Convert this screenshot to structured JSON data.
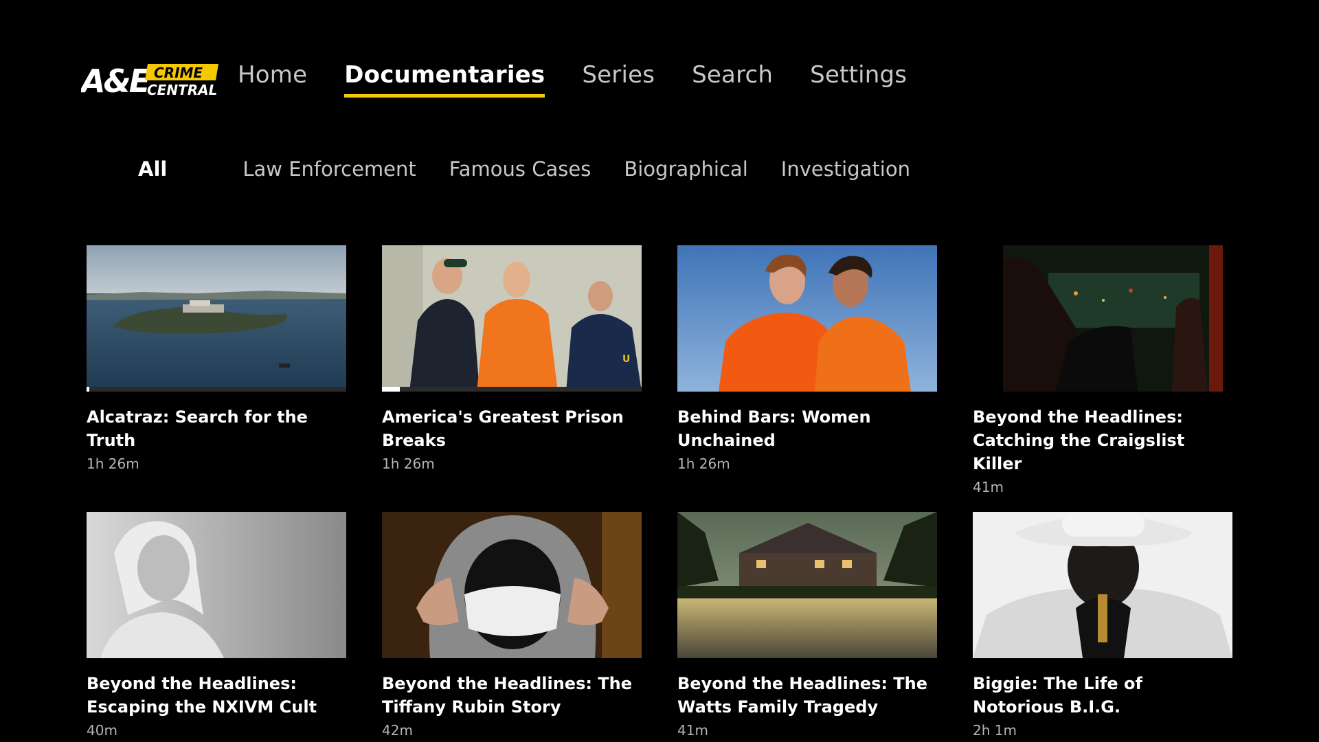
{
  "brand": {
    "logo_primary": "A&E",
    "logo_badge_top": "CRIME",
    "logo_badge_bottom": "CENTRAL",
    "accent_color": "#f5c800"
  },
  "main_nav": {
    "items": [
      {
        "label": "Home"
      },
      {
        "label": "Documentaries",
        "active": true
      },
      {
        "label": "Series"
      },
      {
        "label": "Search"
      },
      {
        "label": "Settings"
      }
    ]
  },
  "sub_nav": {
    "items": [
      {
        "label": "All",
        "active": true
      },
      {
        "label": "Law Enforcement"
      },
      {
        "label": "Famous Cases"
      },
      {
        "label": "Biographical"
      },
      {
        "label": "Investigation"
      }
    ]
  },
  "cards": [
    {
      "title": "Alcatraz: Search for the Truth",
      "duration": "1h 26m",
      "progress": 0.01,
      "thumb_icon": "island-prison-image"
    },
    {
      "title": "America's Greatest Prison Breaks",
      "duration": "1h 26m",
      "progress": 0.07,
      "thumb_icon": "prisoner-officers-image"
    },
    {
      "title": "Behind Bars: Women Unchained",
      "duration": "1h 26m",
      "progress": null,
      "thumb_icon": "women-orange-jumpsuits-image"
    },
    {
      "title": "Beyond the Headlines: Catching the Craigslist Killer",
      "duration": "41m",
      "progress": null,
      "thumb_icon": "dark-bar-scene-image"
    },
    {
      "title": "Beyond the Headlines: Escaping the NXIVM Cult",
      "duration": "40m",
      "progress": null,
      "thumb_icon": "woman-portrait-image"
    },
    {
      "title": "Beyond the Headlines: The Tiffany Rubin Story",
      "duration": "42m",
      "progress": null,
      "thumb_icon": "hooded-masked-figure-image"
    },
    {
      "title": "Beyond the Headlines: The Watts Family Tragedy",
      "duration": "41m",
      "progress": null,
      "thumb_icon": "house-at-dusk-image"
    },
    {
      "title": "Biggie: The Life of Notorious B.I.G.",
      "duration": "2h 1m",
      "progress": null,
      "thumb_icon": "man-white-hat-image"
    }
  ]
}
